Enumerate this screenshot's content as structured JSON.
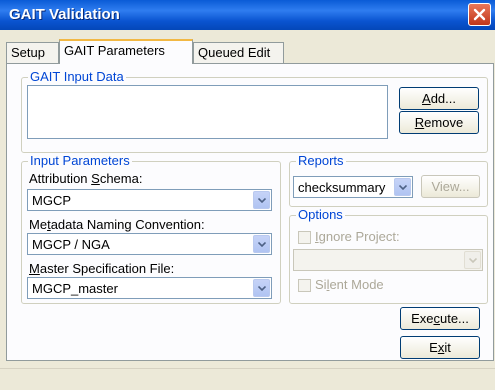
{
  "window": {
    "title": "GAIT Validation"
  },
  "tabs": [
    {
      "label": "Setup",
      "active": false
    },
    {
      "label": "GAIT Parameters",
      "active": true
    },
    {
      "label": "Queued Edit",
      "active": false
    }
  ],
  "input_data": {
    "group_label": "GAIT Input Data",
    "add_pre": "",
    "add_key": "A",
    "add_post": "dd...",
    "remove_pre": "",
    "remove_key": "R",
    "remove_post": "emove"
  },
  "input_params": {
    "group_label": "Input Parameters",
    "schema_label_pre": "Attribution ",
    "schema_label_key": "S",
    "schema_label_post": "chema:",
    "schema_value": "MGCP",
    "metadata_label_pre": "Me",
    "metadata_label_key": "t",
    "metadata_label_post": "adata Naming Convention:",
    "metadata_value": "MGCP / NGA",
    "master_label_pre": "",
    "master_label_key": "M",
    "master_label_post": "aster Specification File:",
    "master_value": "MGCP_master"
  },
  "reports": {
    "group_label": "Reports",
    "value": "checksummary",
    "view_label": "View..."
  },
  "options": {
    "group_label": "Options",
    "ignore_pre": "",
    "ignore_key": "I",
    "ignore_post": "gnore Project:",
    "silent_pre": "Si",
    "silent_key": "l",
    "silent_post": "ent Mode"
  },
  "actions": {
    "execute_pre": "Exe",
    "execute_key": "c",
    "execute_post": "ute...",
    "exit_pre": "E",
    "exit_key": "x",
    "exit_post": "it"
  },
  "colors": {
    "title_bar": "#0a54d0",
    "group_label": "#0046d5",
    "close_button": "#c1361a"
  }
}
